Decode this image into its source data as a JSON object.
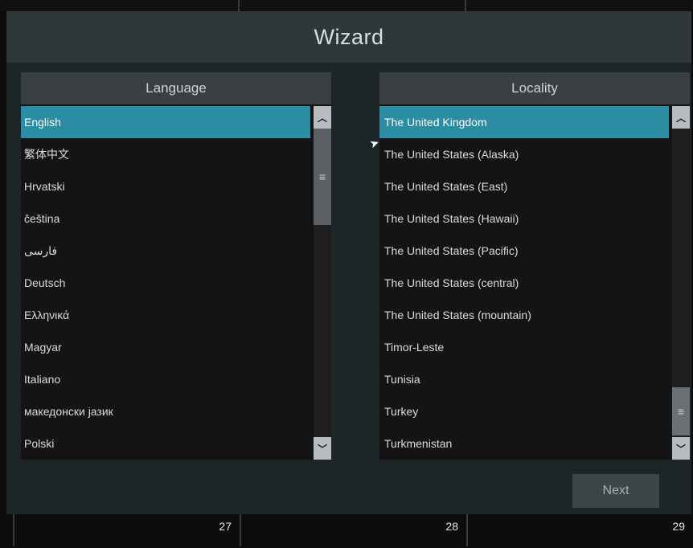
{
  "wizard": {
    "title": "Wizard"
  },
  "language": {
    "header": "Language",
    "items": [
      "English",
      "繁体中文",
      "Hrvatski",
      "čeština",
      "فارسی",
      "Deutsch",
      "Ελληνικά",
      "Magyar",
      "Italiano",
      "македонски јазик",
      "Polski"
    ],
    "selected": "English"
  },
  "locality": {
    "header": "Locality",
    "items": [
      "The United Kingdom",
      "The United States (Alaska)",
      "The United States (East)",
      "The United States (Hawaii)",
      "The United States (Pacific)",
      "The United States (central)",
      "The United States (mountain)",
      "Timor-Leste",
      "Tunisia",
      "Turkey",
      "Turkmenistan"
    ],
    "selected": "The United Kingdom"
  },
  "buttons": {
    "next": "Next"
  },
  "footer": {
    "cells": [
      "27",
      "28",
      "29"
    ]
  },
  "icons": {
    "scroll_up": "chevron-up-icon",
    "scroll_down": "chevron-down-icon",
    "scroll_thumb": "grip-icon",
    "cursor": "mouse-pointer-icon"
  },
  "colors": {
    "selected_row": "#2b8da3",
    "title_bar": "#2e3838",
    "panel_header": "#3a3f42"
  }
}
